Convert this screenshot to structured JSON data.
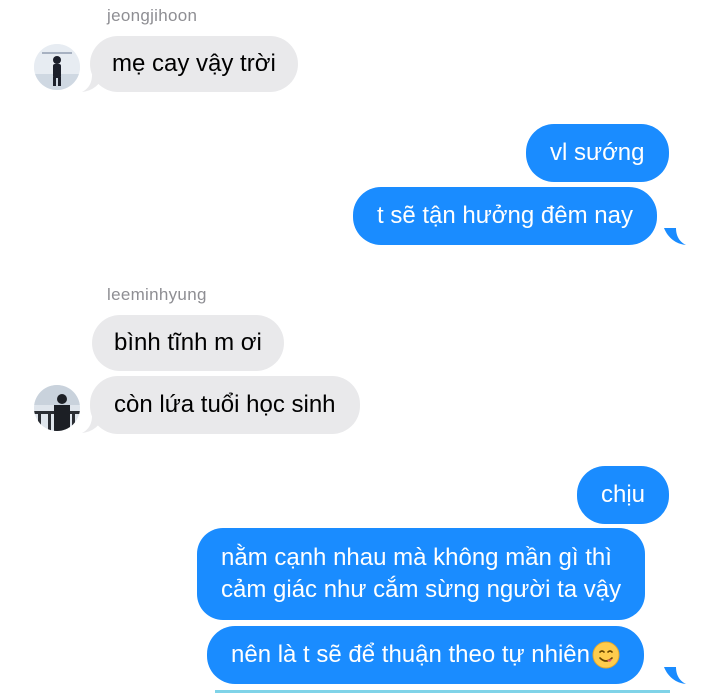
{
  "messages": {
    "group1_sender": "jeongjihoon",
    "m1": "mẹ cay vậy trời",
    "m2": "vl sướng",
    "m3": "t sẽ tận hưởng đêm nay",
    "group2_sender": "leeminhyung",
    "m4": "bình tĩnh m ơi",
    "m5": "còn lứa tuổi học sinh",
    "m6": "chịu",
    "m7_line1": "nằm cạnh nhau mà không mần gì thì",
    "m7_line2": "cảm giác như cắm sừng người ta vậy",
    "m8": "nên là t sẽ để thuận theo tự nhiên"
  },
  "colors": {
    "outgoing": "#1a8cff",
    "incoming": "#e9e9eb",
    "sender_name": "#8e8e93"
  },
  "icons": {
    "m8_emoji": "yum-face-emoji",
    "avatar1": "user-avatar-jeongjihoon",
    "avatar2": "user-avatar-leeminhyung"
  }
}
